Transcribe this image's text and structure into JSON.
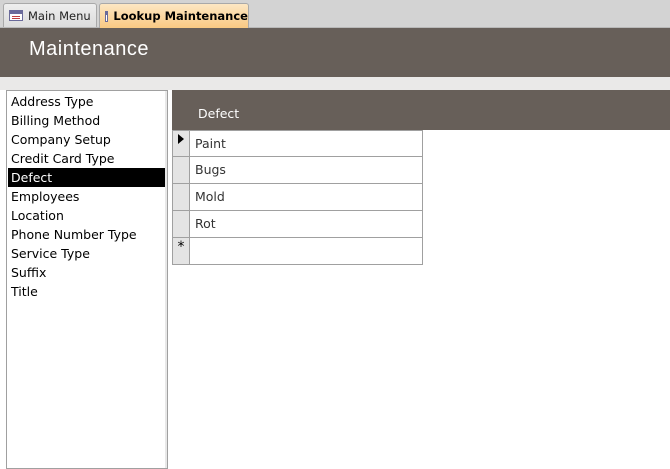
{
  "tabs": [
    {
      "label": "Main Menu",
      "icon": "form-icon",
      "active": false
    },
    {
      "label": "Lookup Maintenance",
      "icon": "form-icon",
      "active": true
    }
  ],
  "header": {
    "title": "Maintenance"
  },
  "lookup_list": {
    "items": [
      "Address Type",
      "Billing Method",
      "Company Setup",
      "Credit Card Type",
      "Defect",
      "Employees",
      "Location",
      "Phone Number Type",
      "Service Type",
      "Suffix",
      "Title"
    ],
    "selected": "Defect"
  },
  "grid": {
    "column_header": "Defect",
    "rows": [
      "Paint",
      "Bugs",
      "Mold",
      "Rot"
    ],
    "new_record_marker": "*",
    "current_record_marker": "triangle-right-icon"
  },
  "colors": {
    "header_bg": "#675f59",
    "active_tab": "#f9c983",
    "selected_item_bg": "#000000"
  }
}
